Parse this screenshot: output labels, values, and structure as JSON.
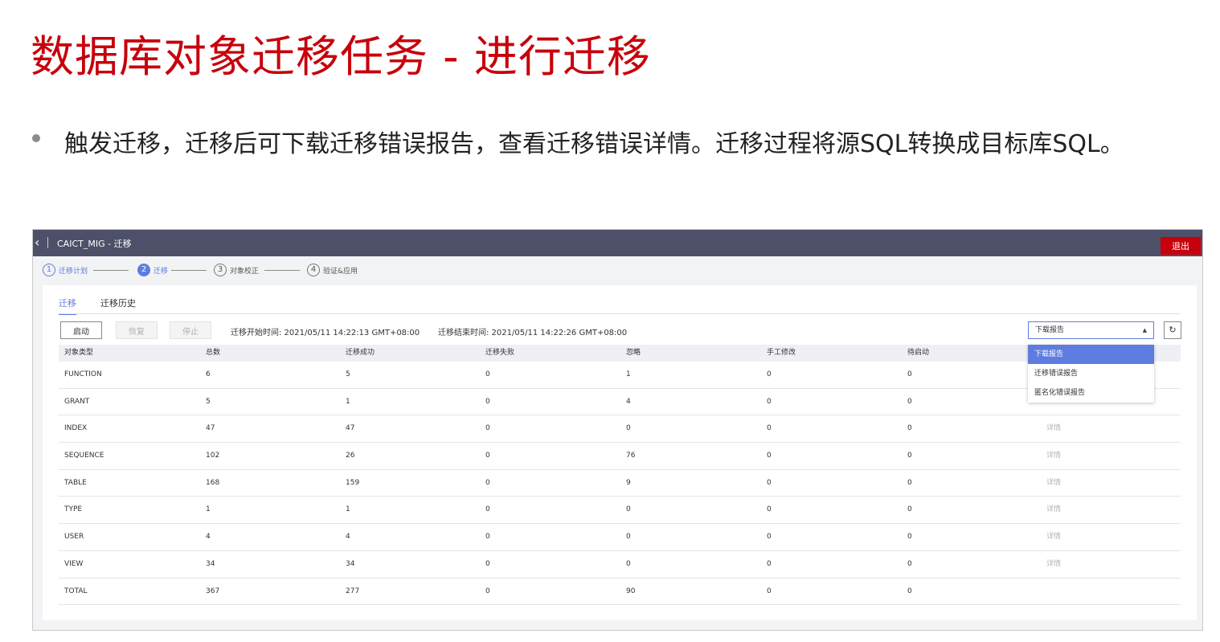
{
  "slide": {
    "title": "数据库对象迁移任务 - 进行迁移",
    "bullet": "触发迁移，迁移后可下载迁移错误报告，查看迁移错误详情。迁移过程将源SQL转换成目标库SQL。"
  },
  "app": {
    "title": "CAICT_MIG - 迁移",
    "exit_label": "退出",
    "steps": [
      {
        "num": "1",
        "label": "迁移计划"
      },
      {
        "num": "2",
        "label": "迁移"
      },
      {
        "num": "3",
        "label": "对象校正"
      },
      {
        "num": "4",
        "label": "验证&应用"
      }
    ],
    "tabs": [
      "迁移",
      "迁移历史"
    ],
    "buttons": {
      "start": "启动",
      "resume": "恢复",
      "stop": "停止"
    },
    "start_time": "迁移开始时间: 2021/05/11 14:22:13 GMT+08:00",
    "end_time": "迁移结束时间: 2021/05/11 14:22:26 GMT+08:00",
    "report_select": {
      "value": "下载报告",
      "options": [
        "下载报告",
        "迁移错误报告",
        "匿名化错误报告"
      ]
    },
    "refresh_icon": "refresh-icon",
    "table": {
      "headers": [
        "对象类型",
        "总数",
        "迁移成功",
        "迁移失败",
        "忽略",
        "手工修改",
        "待启动"
      ],
      "rows": [
        [
          "FUNCTION",
          "6",
          "5",
          "0",
          "1",
          "0",
          "0",
          ""
        ],
        [
          "GRANT",
          "5",
          "1",
          "0",
          "4",
          "0",
          "0",
          ""
        ],
        [
          "INDEX",
          "47",
          "47",
          "0",
          "0",
          "0",
          "0",
          "详情"
        ],
        [
          "SEQUENCE",
          "102",
          "26",
          "0",
          "76",
          "0",
          "0",
          "详情"
        ],
        [
          "TABLE",
          "168",
          "159",
          "0",
          "9",
          "0",
          "0",
          "详情"
        ],
        [
          "TYPE",
          "1",
          "1",
          "0",
          "0",
          "0",
          "0",
          "详情"
        ],
        [
          "USER",
          "4",
          "4",
          "0",
          "0",
          "0",
          "0",
          "详情"
        ],
        [
          "VIEW",
          "34",
          "34",
          "0",
          "0",
          "0",
          "0",
          "详情"
        ],
        [
          "TOTAL",
          "367",
          "277",
          "0",
          "90",
          "0",
          "0",
          ""
        ]
      ]
    },
    "colors": {
      "accent": "#5e7ce0",
      "brand_red": "#c7000b",
      "topbar": "#4d5068"
    }
  }
}
